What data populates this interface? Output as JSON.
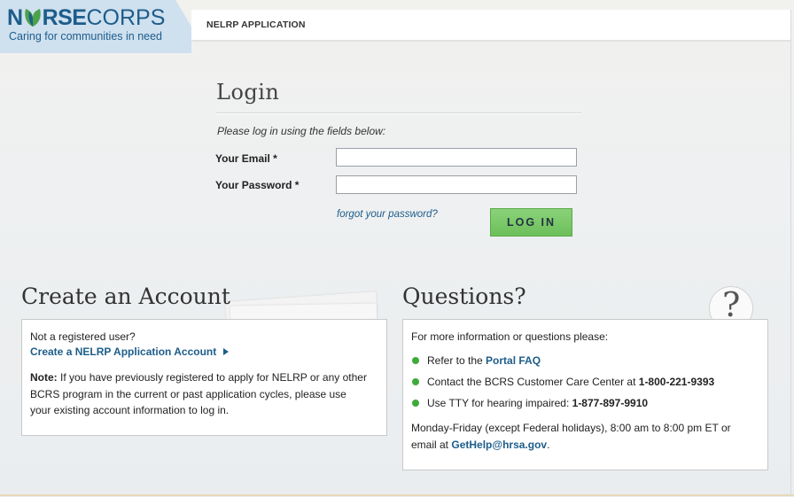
{
  "header": {
    "logo_part1": "N",
    "logo_part2": "RSE",
    "logo_part3": "CORPS",
    "logo_tagline": "Caring for communities in need",
    "app_title": "NELRP APPLICATION"
  },
  "login": {
    "title": "Login",
    "hint": "Please log in using the fields below:",
    "email_label": "Your Email *",
    "email_value": "",
    "password_label": "Your Password *",
    "password_value": "",
    "forgot_link": "forgot your password?",
    "login_button": "LOG IN"
  },
  "create_account": {
    "title": "Create an Account",
    "question": "Not a registered user?",
    "link": "Create a NELRP Application Account",
    "note_label": "Note:",
    "note_line1": " If you have previously registered to apply for NELRP or any other",
    "note_line2": "BCRS program in the current or past application cycles, please use",
    "note_line3": "your existing account information to log in."
  },
  "questions": {
    "title": "Questions?",
    "intro": "For more information or questions please:",
    "item1_text": "Refer to the ",
    "item1_link": "Portal FAQ",
    "item2_text": "Contact the BCRS Customer Care Center at ",
    "item2_phone": "1-800-221-9393",
    "item3_text": "Use TTY for hearing impaired: ",
    "item3_phone": "1-877-897-9910",
    "hours": "Monday-Friday (except Federal holidays), 8:00 am to 8:00 pm ET or",
    "email_prefix": "email at ",
    "email_link": "GetHelp@hrsa.gov",
    "email_suffix": "."
  },
  "colors": {
    "accent": "#1d5d8a",
    "button_green": "#6cbf5a",
    "bullet_green": "#3faa3a"
  },
  "icons": [
    "nurse-corps-leaf-icon",
    "arrow-right-icon",
    "question-mark-icon",
    "bullet-dot-icon"
  ]
}
